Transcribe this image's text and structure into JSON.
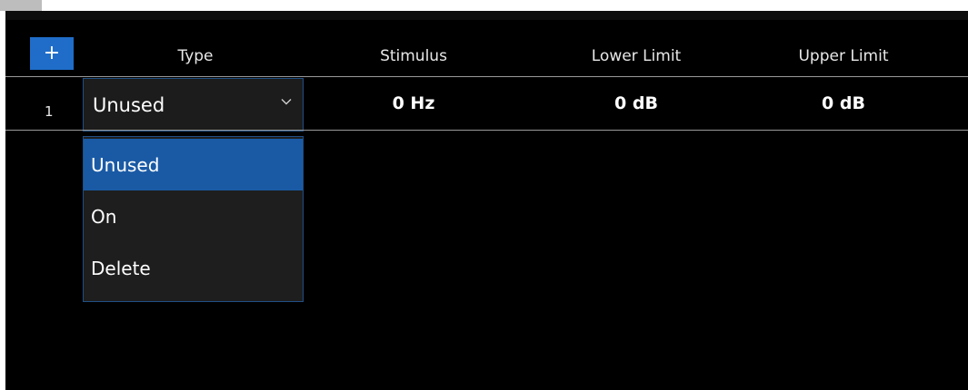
{
  "toolbar": {
    "add_label": "+"
  },
  "table": {
    "headers": [
      "Type",
      "Stimulus",
      "Lower Limit",
      "Upper Limit"
    ],
    "rows": [
      {
        "index": "1",
        "type": "Unused",
        "stimulus": "0 Hz",
        "lower_limit": "0 dB",
        "upper_limit": "0 dB"
      }
    ]
  },
  "type_dropdown": {
    "options": [
      "Unused",
      "On",
      "Delete"
    ],
    "selected": "Unused"
  },
  "colors": {
    "background": "#000000",
    "accent": "#1a5aa5",
    "add_button": "#1f6dc9"
  },
  "icons": {
    "add": "plus-icon",
    "expand": "chevron-down-icon"
  }
}
